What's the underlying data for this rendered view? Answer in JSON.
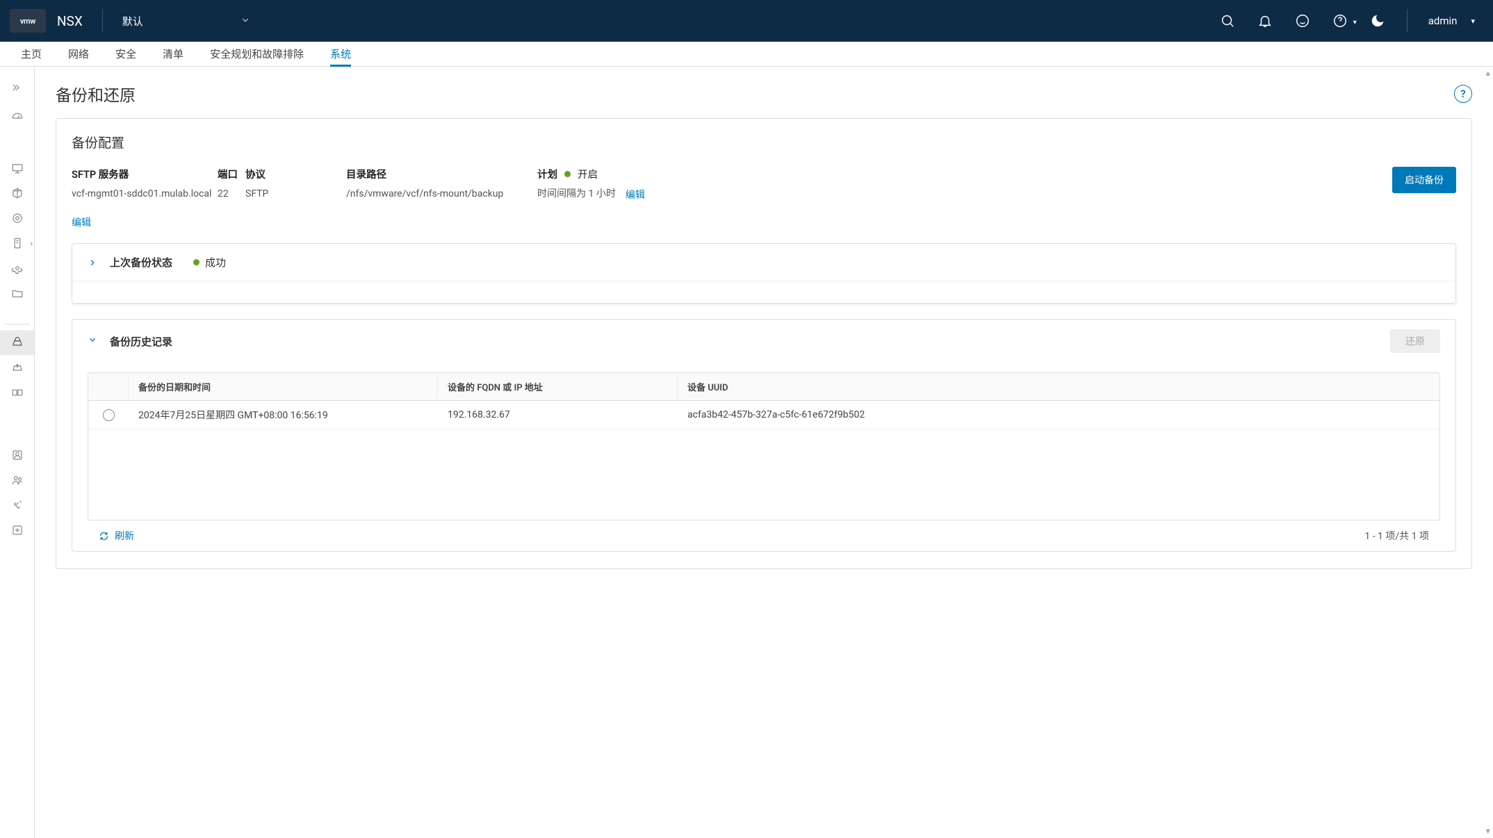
{
  "header": {
    "logo_text": "vmw",
    "product": "NSX",
    "context": "默认",
    "user": "admin"
  },
  "tabs": {
    "items": [
      "主页",
      "网络",
      "安全",
      "清单",
      "安全规划和故障排除",
      "系统"
    ],
    "active_index": 5
  },
  "page": {
    "title": "备份和还原"
  },
  "config": {
    "title": "备份配置",
    "sftp_label": "SFTP 服务器",
    "sftp_value": "vcf-mgmt01-sddc01.mulab.local",
    "port_label": "端口",
    "port_value": "22",
    "proto_label": "协议",
    "proto_value": "SFTP",
    "path_label": "目录路径",
    "path_value": "/nfs/vmware/vcf/nfs-mount/backup",
    "sched_label": "计划",
    "sched_state": "开启",
    "sched_value": "时间间隔为 1 小时",
    "edit_link": "编辑",
    "edit_link2": "编辑",
    "start_button": "启动备份"
  },
  "last_status": {
    "label": "上次备份状态",
    "value": "成功"
  },
  "history": {
    "label": "备份历史记录",
    "restore_button": "还原",
    "columns": {
      "date": "备份的日期和时间",
      "fqdn": "设备的 FQDN 或 IP 地址",
      "uuid": "设备 UUID"
    },
    "rows": [
      {
        "date": "2024年7月25日星期四 GMT+08:00 16:56:19",
        "fqdn": "192.168.32.67",
        "uuid": "acfa3b42-457b-327a-c5fc-61e672f9b502"
      }
    ],
    "refresh_label": "刷新",
    "pager": "1 - 1 项/共 1 项"
  }
}
